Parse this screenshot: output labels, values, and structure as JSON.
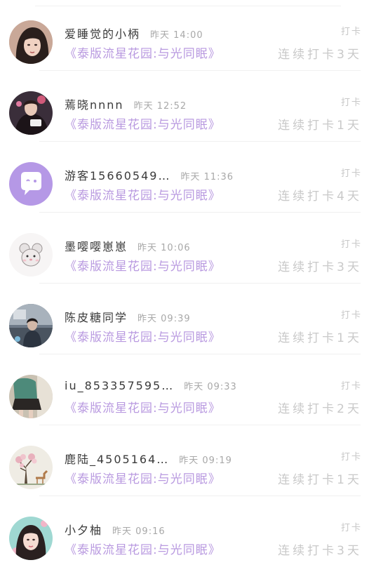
{
  "entries": [
    {
      "name": "爱睡觉的小柄",
      "time": "昨天 14:00",
      "book": "《泰版流星花园:与光同眠》",
      "checkin": "打卡",
      "streak": "连续打卡3天",
      "avatar": "girl-dark-hair-avatar"
    },
    {
      "name": "蔫晓nnnn",
      "time": "昨天 12:52",
      "book": "《泰版流星花园:与光同眠》",
      "checkin": "打卡",
      "streak": "连续打卡1天",
      "avatar": "girl-photo-avatar"
    },
    {
      "name": "游客15660549…",
      "time": "昨天 11:36",
      "book": "《泰版流星花园:与光同眠》",
      "checkin": "打卡",
      "streak": "连续打卡4天",
      "avatar": "default-chat-bubble-avatar"
    },
    {
      "name": "墨嘤嘤崽崽",
      "time": "昨天 10:06",
      "book": "《泰版流星花园:与光同眠》",
      "checkin": "打卡",
      "streak": "连续打卡3天",
      "avatar": "mouse-sticker-avatar"
    },
    {
      "name": "陈皮糖同学",
      "time": "昨天 09:39",
      "book": "《泰版流星花园:与光同眠》",
      "checkin": "打卡",
      "streak": "连续打卡1天",
      "avatar": "room-photo-avatar"
    },
    {
      "name": "iu_853357595…",
      "time": "昨天 09:33",
      "book": "《泰版流星花园:与光同眠》",
      "checkin": "打卡",
      "streak": "连续打卡2天",
      "avatar": "green-outfit-avatar"
    },
    {
      "name": "鹿陆_4505164…",
      "time": "昨天 09:19",
      "book": "《泰版流星花园:与光同眠》",
      "checkin": "打卡",
      "streak": "连续打卡1天",
      "avatar": "tree-deer-avatar"
    },
    {
      "name": "小夕柚",
      "time": "昨天 09:16",
      "book": "《泰版流星花园:与光同眠》",
      "checkin": "打卡",
      "streak": "连续打卡3天",
      "avatar": "girl-portrait-avatar"
    }
  ]
}
